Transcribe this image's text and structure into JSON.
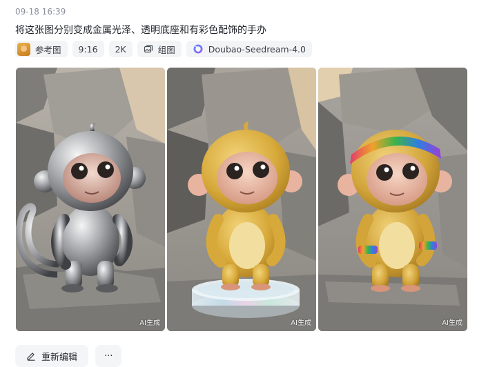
{
  "message": {
    "timestamp": "09-18 16:39",
    "prompt": "将这张图分别变成金属光泽、透明底座和有彩色配饰的手办"
  },
  "tags": {
    "reference_label": "参考图",
    "ratio": "9:16",
    "resolution": "2K",
    "group_label": "组图",
    "model": "Doubao-Seedream-4.0"
  },
  "images": [
    {
      "variant": "metallic",
      "ai_label": "AI生成"
    },
    {
      "variant": "transparent-base",
      "ai_label": "AI生成"
    },
    {
      "variant": "colorful-accessories",
      "ai_label": "AI生成"
    }
  ],
  "actions": {
    "regenerate_label": "重新编辑",
    "more_label": "···"
  },
  "icons": {
    "edit": "pencil-icon",
    "group": "image-group-icon",
    "model": "doubao-logo-icon",
    "more": "more-icon"
  },
  "colors": {
    "tag_background": "#f3f4f6",
    "model_logo": "#7b5cf5"
  }
}
